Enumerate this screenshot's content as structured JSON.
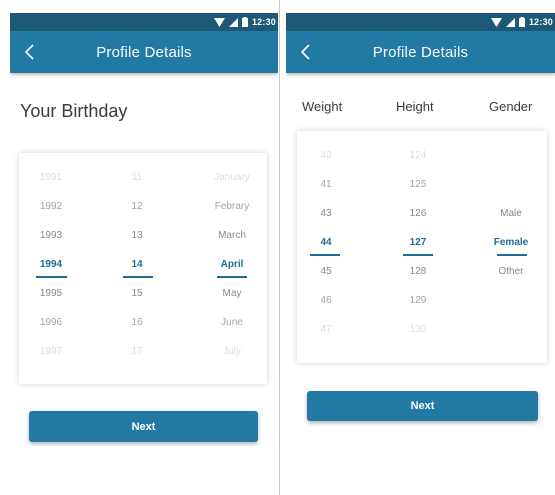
{
  "colors": {
    "statusbar": "#1d5877",
    "appbar": "#2279a3",
    "accent": "#1f6d96",
    "heading": "#3b3b3b"
  },
  "left": {
    "status": {
      "time": "12:30"
    },
    "appbar": {
      "title": "Profile Details",
      "back_icon": "back-arrow-icon"
    },
    "heading": "Your Birthday",
    "picker": {
      "years": [
        "1991",
        "1992",
        "1993",
        "1994",
        "1995",
        "1996",
        "1997"
      ],
      "days": [
        "11",
        "12",
        "13",
        "14",
        "15",
        "16",
        "17"
      ],
      "months": [
        "January",
        "Febrary",
        "March",
        "April",
        "May",
        "June",
        "July"
      ],
      "selected_index": 3
    },
    "next_label": "Next"
  },
  "right": {
    "status": {
      "time": "12:30"
    },
    "appbar": {
      "title": "Profile Details",
      "back_icon": "back-arrow-icon"
    },
    "headers": {
      "weight": "Weight",
      "height": "Height",
      "gender": "Gender"
    },
    "picker": {
      "weights": [
        "40",
        "41",
        "43",
        "44",
        "45",
        "46",
        "47"
      ],
      "heights": [
        "124",
        "125",
        "126",
        "127",
        "128",
        "129",
        "130"
      ],
      "genders": [
        "",
        "",
        "Male",
        "Female",
        "Other",
        "",
        ""
      ],
      "selected_index": 3
    },
    "next_label": "Next"
  }
}
